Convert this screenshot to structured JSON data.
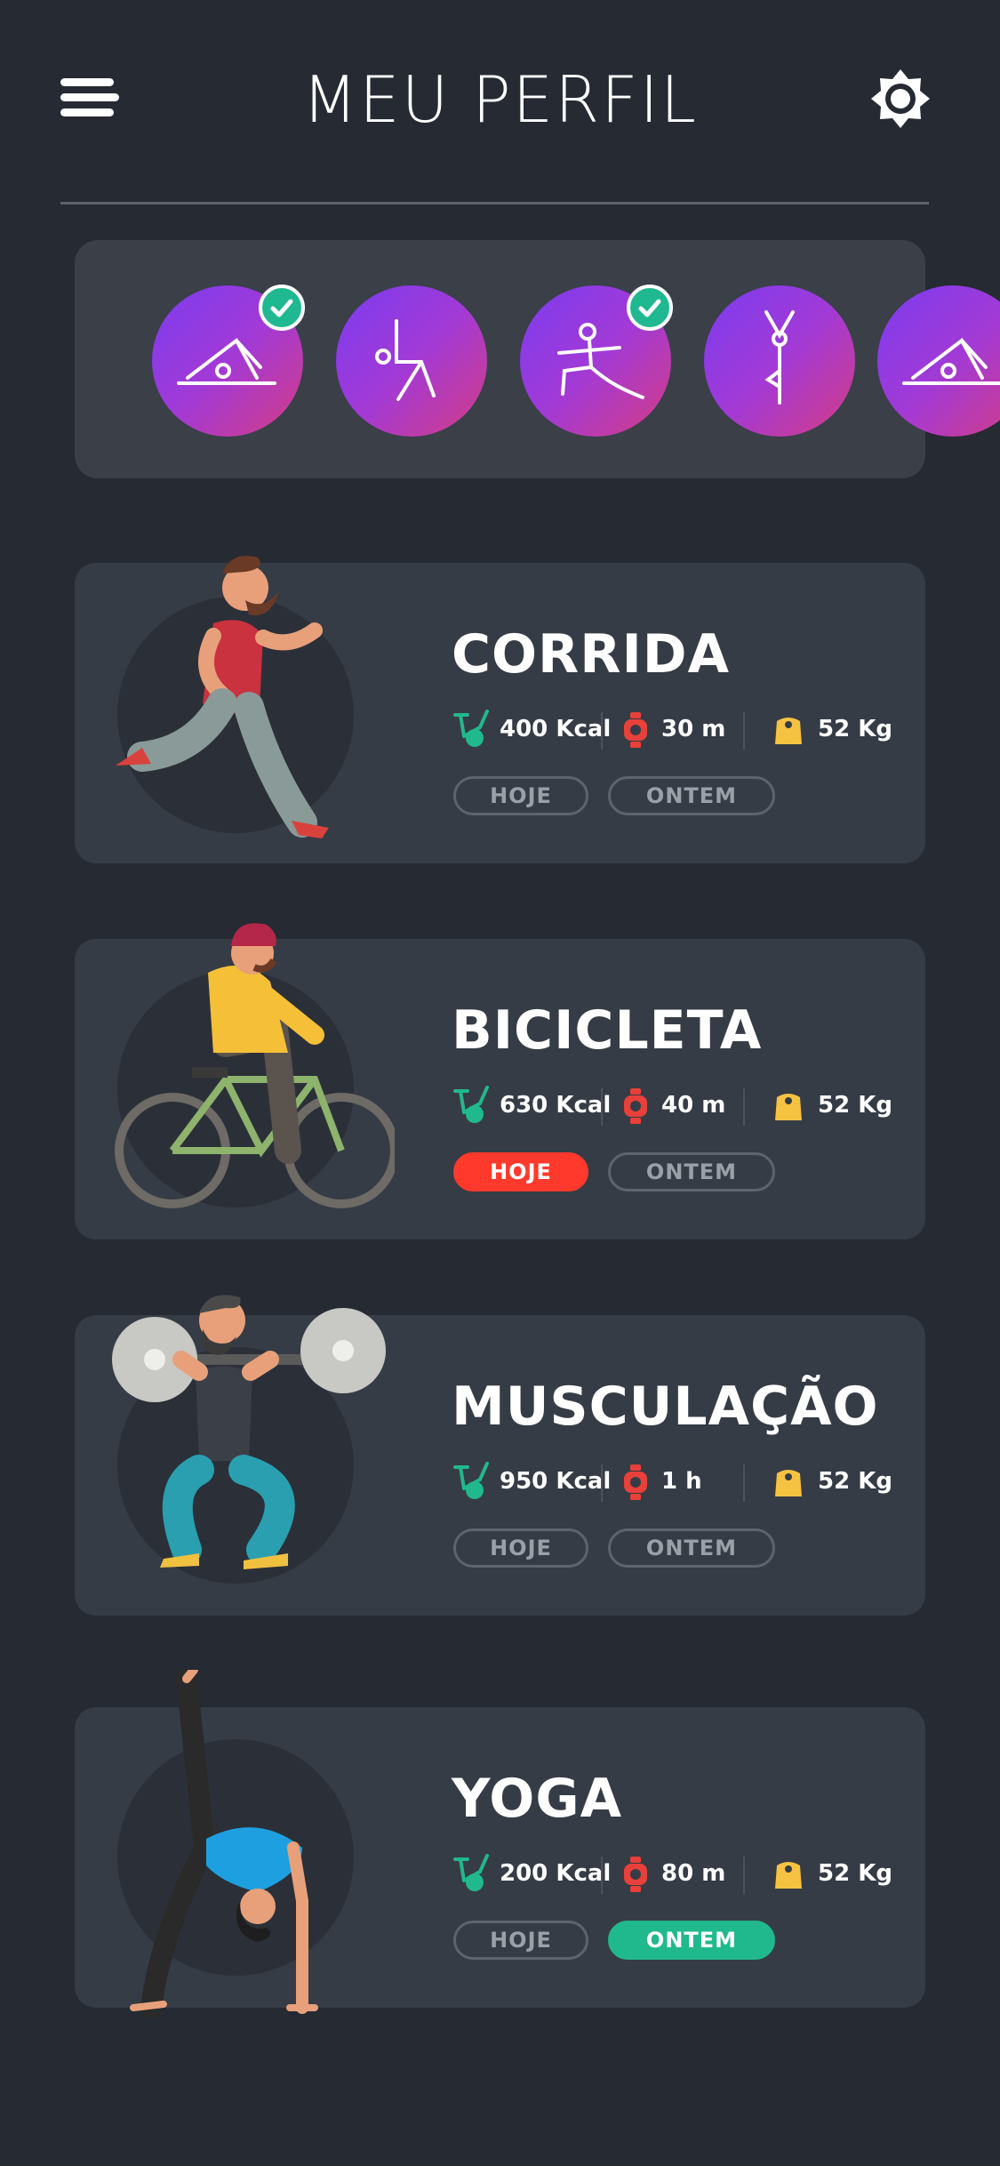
{
  "header": {
    "title": "MEU PERFIL",
    "menu_icon": "hamburger-menu-icon",
    "settings_icon": "gear-icon"
  },
  "carousel": {
    "items": [
      {
        "icon": "yoga-pose-downward-dog-icon",
        "completed": true
      },
      {
        "icon": "yoga-pose-seated-icon",
        "completed": false
      },
      {
        "icon": "yoga-pose-warrior-icon",
        "completed": true
      },
      {
        "icon": "yoga-pose-tree-icon",
        "completed": false
      },
      {
        "icon": "yoga-pose-downward-dog-icon",
        "completed": false
      }
    ]
  },
  "activities": [
    {
      "title": "CORRIDA",
      "kcal": "400 Kcal",
      "time": "30 m",
      "weight": "52 Kg",
      "today": "HOJE",
      "yesterday": "ONTEM",
      "active": "none"
    },
    {
      "title": "BICICLETA",
      "kcal": "630 Kcal",
      "time": "40 m",
      "weight": "52 Kg",
      "today": "HOJE",
      "yesterday": "ONTEM",
      "active": "today"
    },
    {
      "title": "MUSCULAÇÃO",
      "kcal": "950 Kcal",
      "time": "1 h",
      "weight": "52 Kg",
      "today": "HOJE",
      "yesterday": "ONTEM",
      "active": "none"
    },
    {
      "title": "YOGA",
      "kcal": "200 Kcal",
      "time": "80 m",
      "weight": "52 Kg",
      "today": "HOJE",
      "yesterday": "ONTEM",
      "active": "yesterday"
    }
  ],
  "colors": {
    "background": "#252a33",
    "card": "#363c45",
    "today_active": "#ff3a2c",
    "yesterday_active": "#20b98d",
    "kcal_icon": "#20b98d",
    "time_icon": "#e8403a",
    "weight_icon": "#f5c242"
  }
}
